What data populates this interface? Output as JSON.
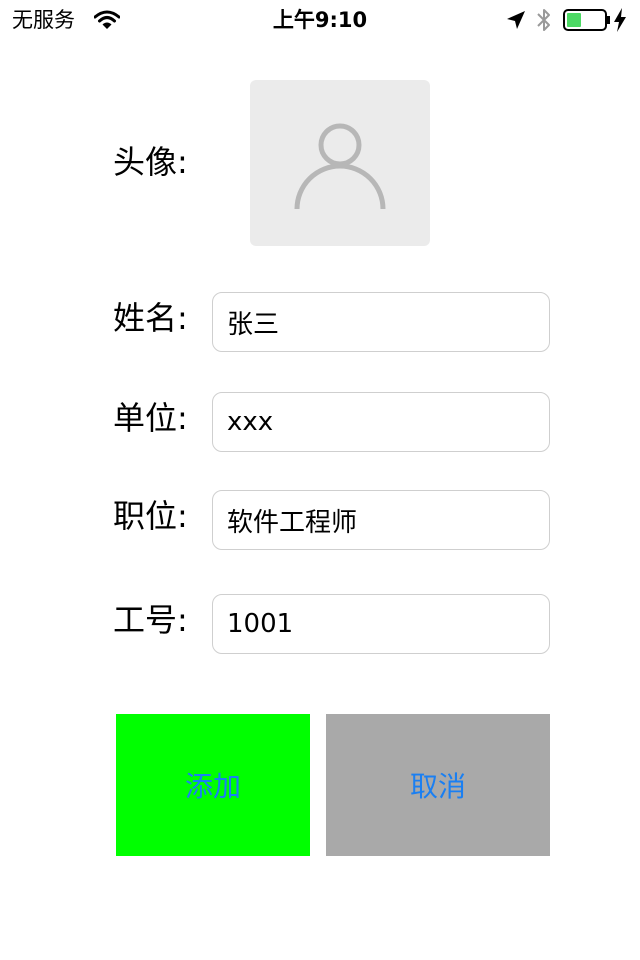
{
  "status_bar": {
    "carrier": "无服务",
    "time": "上午9:10",
    "battery_color": "#4cd964"
  },
  "form": {
    "avatar_label": "头像:",
    "name_label": "姓名:",
    "name_value": "张三",
    "company_label": "单位:",
    "company_value": "xxx",
    "position_label": "职位:",
    "position_value": "软件工程师",
    "employee_id_label": "工号:",
    "employee_id_value": "1001"
  },
  "buttons": {
    "add_label": "添加",
    "add_bg": "#00ff00",
    "cancel_label": "取消",
    "cancel_bg": "#a9a9a9",
    "text_color": "#1a7ff2"
  },
  "icons": {
    "wifi": "wifi-icon",
    "location": "location-arrow-icon",
    "bluetooth": "bluetooth-icon",
    "battery": "battery-icon",
    "charging": "charging-bolt-icon",
    "avatar": "person-placeholder-icon"
  }
}
